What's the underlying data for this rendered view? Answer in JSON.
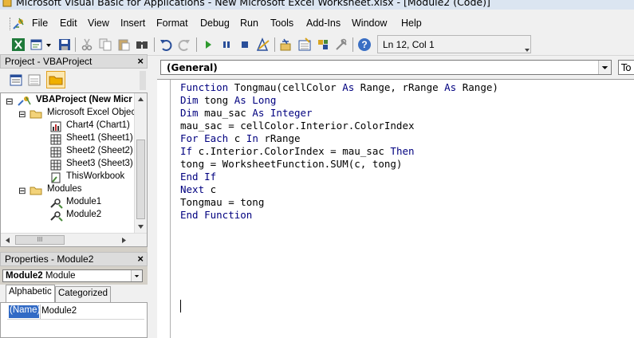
{
  "window": {
    "title": "Microsoft Visual Basic for Applications - New Microsoft Excel Worksheet.xlsx - [Module2 (Code)]"
  },
  "menu": {
    "items": [
      "File",
      "Edit",
      "View",
      "Insert",
      "Format",
      "Debug",
      "Run",
      "Tools",
      "Add-Ins",
      "Window",
      "Help"
    ]
  },
  "toolbar": {
    "cursor_position": "Ln 12, Col 1",
    "icons": [
      "view-excel-icon",
      "insert-module-icon",
      "save-icon",
      "cut-icon",
      "copy-icon",
      "paste-icon",
      "find-icon",
      "undo-icon",
      "redo-icon",
      "run-icon",
      "break-icon",
      "reset-icon",
      "design-mode-icon",
      "project-explorer-icon",
      "properties-window-icon",
      "object-browser-icon",
      "toolbox-icon",
      "help-icon"
    ]
  },
  "project_pane": {
    "title": "Project - VBAProject",
    "close": "×",
    "tree": [
      {
        "label": "VBAProject (New Micr",
        "bold": true
      },
      {
        "label": "Microsoft Excel Objec"
      },
      {
        "label": "Chart4 (Chart1)"
      },
      {
        "label": "Sheet1 (Sheet1)"
      },
      {
        "label": "Sheet2 (Sheet2)"
      },
      {
        "label": "Sheet3 (Sheet3)"
      },
      {
        "label": "ThisWorkbook"
      },
      {
        "label": "Modules"
      },
      {
        "label": "Module1"
      },
      {
        "label": "Module2"
      }
    ],
    "hscroll_thumb": "III"
  },
  "properties_pane": {
    "title": "Properties - Module2",
    "close": "×",
    "object_name": "Module2",
    "object_type": "Module",
    "tabs": [
      "Alphabetic",
      "Categorized"
    ],
    "rows": [
      {
        "name": "(Name)",
        "value": "Module2"
      }
    ]
  },
  "code_window": {
    "object_combo": "(General)",
    "procedure_combo": "To",
    "lines": [
      [
        {
          "t": "Function ",
          "k": true
        },
        {
          "t": "Tongmau(cellColor "
        },
        {
          "t": "As",
          "k": true
        },
        {
          "t": " Range, rRange "
        },
        {
          "t": "As",
          "k": true
        },
        {
          "t": " Range)"
        }
      ],
      [
        {
          "t": "Dim",
          "k": true
        },
        {
          "t": " tong "
        },
        {
          "t": "As Long",
          "k": true
        }
      ],
      [
        {
          "t": "Dim",
          "k": true
        },
        {
          "t": " mau_sac "
        },
        {
          "t": "As Integer",
          "k": true
        }
      ],
      [
        {
          "t": "mau_sac = cellColor.Interior.ColorIndex"
        }
      ],
      [
        {
          "t": "For Each",
          "k": true
        },
        {
          "t": " c "
        },
        {
          "t": "In",
          "k": true
        },
        {
          "t": " rRange"
        }
      ],
      [
        {
          "t": "If",
          "k": true
        },
        {
          "t": " c.Interior.ColorIndex = mau_sac "
        },
        {
          "t": "Then",
          "k": true
        }
      ],
      [
        {
          "t": "tong = WorksheetFunction.SUM(c, tong)"
        }
      ],
      [
        {
          "t": "End If",
          "k": true
        }
      ],
      [
        {
          "t": "Next",
          "k": true
        },
        {
          "t": " c"
        }
      ],
      [
        {
          "t": "Tongmau = tong"
        }
      ],
      [
        {
          "t": "End Function",
          "k": true
        }
      ]
    ]
  },
  "colors": {
    "keyword": "#00007f",
    "selection": "#316ac5"
  }
}
